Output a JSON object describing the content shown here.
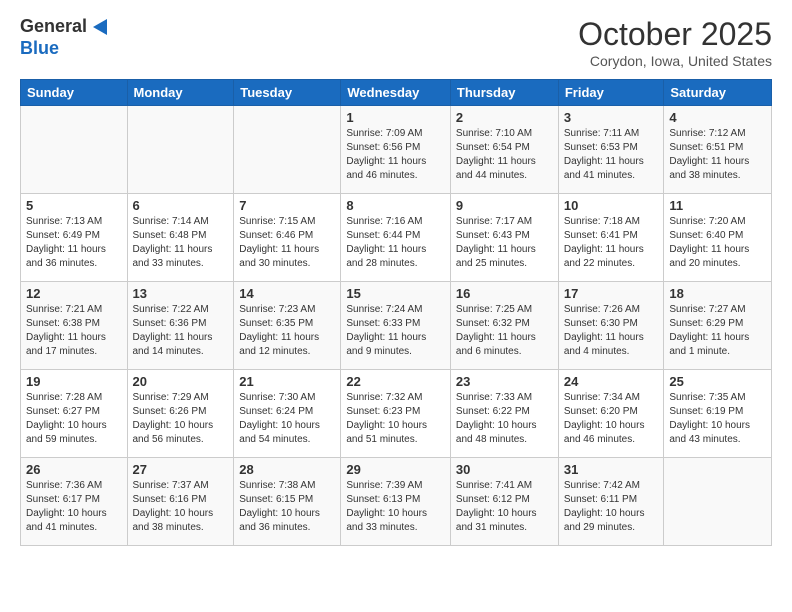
{
  "logo": {
    "general": "General",
    "blue": "Blue"
  },
  "title": {
    "month": "October 2025",
    "location": "Corydon, Iowa, United States"
  },
  "weekdays": [
    "Sunday",
    "Monday",
    "Tuesday",
    "Wednesday",
    "Thursday",
    "Friday",
    "Saturday"
  ],
  "weeks": [
    [
      {
        "day": "",
        "info": ""
      },
      {
        "day": "",
        "info": ""
      },
      {
        "day": "",
        "info": ""
      },
      {
        "day": "1",
        "info": "Sunrise: 7:09 AM\nSunset: 6:56 PM\nDaylight: 11 hours and 46 minutes."
      },
      {
        "day": "2",
        "info": "Sunrise: 7:10 AM\nSunset: 6:54 PM\nDaylight: 11 hours and 44 minutes."
      },
      {
        "day": "3",
        "info": "Sunrise: 7:11 AM\nSunset: 6:53 PM\nDaylight: 11 hours and 41 minutes."
      },
      {
        "day": "4",
        "info": "Sunrise: 7:12 AM\nSunset: 6:51 PM\nDaylight: 11 hours and 38 minutes."
      }
    ],
    [
      {
        "day": "5",
        "info": "Sunrise: 7:13 AM\nSunset: 6:49 PM\nDaylight: 11 hours and 36 minutes."
      },
      {
        "day": "6",
        "info": "Sunrise: 7:14 AM\nSunset: 6:48 PM\nDaylight: 11 hours and 33 minutes."
      },
      {
        "day": "7",
        "info": "Sunrise: 7:15 AM\nSunset: 6:46 PM\nDaylight: 11 hours and 30 minutes."
      },
      {
        "day": "8",
        "info": "Sunrise: 7:16 AM\nSunset: 6:44 PM\nDaylight: 11 hours and 28 minutes."
      },
      {
        "day": "9",
        "info": "Sunrise: 7:17 AM\nSunset: 6:43 PM\nDaylight: 11 hours and 25 minutes."
      },
      {
        "day": "10",
        "info": "Sunrise: 7:18 AM\nSunset: 6:41 PM\nDaylight: 11 hours and 22 minutes."
      },
      {
        "day": "11",
        "info": "Sunrise: 7:20 AM\nSunset: 6:40 PM\nDaylight: 11 hours and 20 minutes."
      }
    ],
    [
      {
        "day": "12",
        "info": "Sunrise: 7:21 AM\nSunset: 6:38 PM\nDaylight: 11 hours and 17 minutes."
      },
      {
        "day": "13",
        "info": "Sunrise: 7:22 AM\nSunset: 6:36 PM\nDaylight: 11 hours and 14 minutes."
      },
      {
        "day": "14",
        "info": "Sunrise: 7:23 AM\nSunset: 6:35 PM\nDaylight: 11 hours and 12 minutes."
      },
      {
        "day": "15",
        "info": "Sunrise: 7:24 AM\nSunset: 6:33 PM\nDaylight: 11 hours and 9 minutes."
      },
      {
        "day": "16",
        "info": "Sunrise: 7:25 AM\nSunset: 6:32 PM\nDaylight: 11 hours and 6 minutes."
      },
      {
        "day": "17",
        "info": "Sunrise: 7:26 AM\nSunset: 6:30 PM\nDaylight: 11 hours and 4 minutes."
      },
      {
        "day": "18",
        "info": "Sunrise: 7:27 AM\nSunset: 6:29 PM\nDaylight: 11 hours and 1 minute."
      }
    ],
    [
      {
        "day": "19",
        "info": "Sunrise: 7:28 AM\nSunset: 6:27 PM\nDaylight: 10 hours and 59 minutes."
      },
      {
        "day": "20",
        "info": "Sunrise: 7:29 AM\nSunset: 6:26 PM\nDaylight: 10 hours and 56 minutes."
      },
      {
        "day": "21",
        "info": "Sunrise: 7:30 AM\nSunset: 6:24 PM\nDaylight: 10 hours and 54 minutes."
      },
      {
        "day": "22",
        "info": "Sunrise: 7:32 AM\nSunset: 6:23 PM\nDaylight: 10 hours and 51 minutes."
      },
      {
        "day": "23",
        "info": "Sunrise: 7:33 AM\nSunset: 6:22 PM\nDaylight: 10 hours and 48 minutes."
      },
      {
        "day": "24",
        "info": "Sunrise: 7:34 AM\nSunset: 6:20 PM\nDaylight: 10 hours and 46 minutes."
      },
      {
        "day": "25",
        "info": "Sunrise: 7:35 AM\nSunset: 6:19 PM\nDaylight: 10 hours and 43 minutes."
      }
    ],
    [
      {
        "day": "26",
        "info": "Sunrise: 7:36 AM\nSunset: 6:17 PM\nDaylight: 10 hours and 41 minutes."
      },
      {
        "day": "27",
        "info": "Sunrise: 7:37 AM\nSunset: 6:16 PM\nDaylight: 10 hours and 38 minutes."
      },
      {
        "day": "28",
        "info": "Sunrise: 7:38 AM\nSunset: 6:15 PM\nDaylight: 10 hours and 36 minutes."
      },
      {
        "day": "29",
        "info": "Sunrise: 7:39 AM\nSunset: 6:13 PM\nDaylight: 10 hours and 33 minutes."
      },
      {
        "day": "30",
        "info": "Sunrise: 7:41 AM\nSunset: 6:12 PM\nDaylight: 10 hours and 31 minutes."
      },
      {
        "day": "31",
        "info": "Sunrise: 7:42 AM\nSunset: 6:11 PM\nDaylight: 10 hours and 29 minutes."
      },
      {
        "day": "",
        "info": ""
      }
    ]
  ]
}
